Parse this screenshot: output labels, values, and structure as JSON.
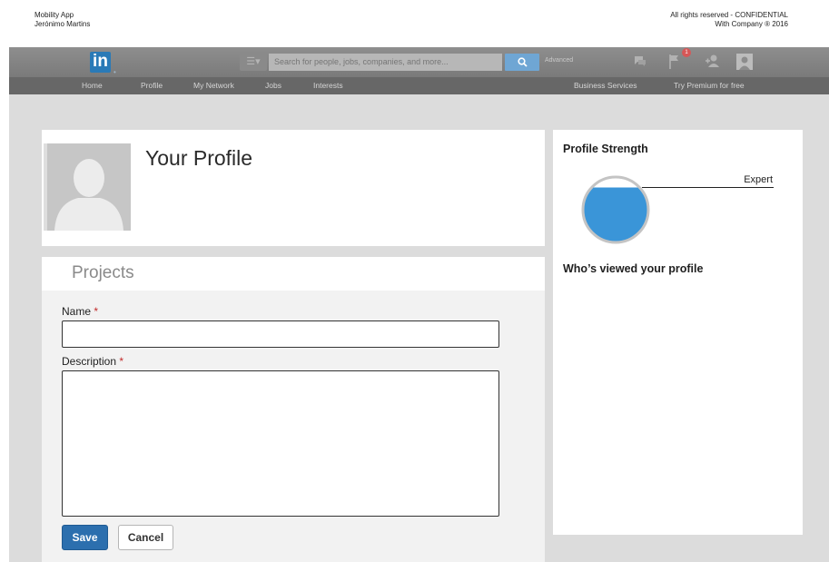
{
  "doc": {
    "app_name": "Mobility App",
    "author": "Jerónimo Martins",
    "rights": "All rights reserved - CONFIDENTIAL",
    "company": "With Company ® 2016"
  },
  "topbar": {
    "logo": "in",
    "search_placeholder": "Search for people, jobs, companies, and more...",
    "advanced_label": "Advanced",
    "notification_count": "1"
  },
  "nav": {
    "items": [
      "Home",
      "Profile",
      "My Network",
      "Jobs",
      "Interests"
    ],
    "business": "Business Services",
    "premium": "Try Premium for free"
  },
  "profile": {
    "title": "Your Profile"
  },
  "projects": {
    "title": "Projects",
    "name_label": "Name",
    "description_label": "Description",
    "required_mark": "*",
    "name_value": "",
    "description_value": "",
    "save_label": "Save",
    "cancel_label": "Cancel"
  },
  "sidebar": {
    "strength_title": "Profile Strength",
    "strength_level": "Expert",
    "strength_fill": 0.85,
    "viewers_title": "Who’s viewed your profile"
  },
  "colors": {
    "accent": "#2c6fae",
    "gauge_fill": "#3a95d8",
    "required": "#c22b2b"
  }
}
